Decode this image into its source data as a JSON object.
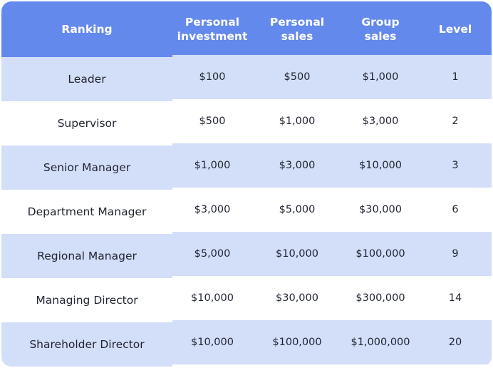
{
  "table": {
    "headers": [
      "Ranking",
      "Personal investment",
      "Personal sales",
      "Group sales",
      "Level"
    ],
    "rows": [
      [
        "Leader",
        "$100",
        "$500",
        "$1,000",
        "1"
      ],
      [
        "Supervisor",
        "$500",
        "$1,000",
        "$3,000",
        "2"
      ],
      [
        "Senior Manager",
        "$1,000",
        "$3,000",
        "$10,000",
        "3"
      ],
      [
        "Department Manager",
        "$3,000",
        "$5,000",
        "$30,000",
        "6"
      ],
      [
        "Regional Manager",
        "$5,000",
        "$10,000",
        "$100,000",
        "9"
      ],
      [
        "Managing Director",
        "$10,000",
        "$30,000",
        "$300,000",
        "14"
      ],
      [
        "Shareholder Director",
        "$10,000",
        "$100,000",
        "$1,000,000",
        "20"
      ]
    ]
  },
  "colors": {
    "header_bg": "#6489ec",
    "header_text": "#ffffff",
    "row_shade": "#d3def9",
    "row_plain": "#ffffff",
    "body_text": "#1f2430"
  }
}
